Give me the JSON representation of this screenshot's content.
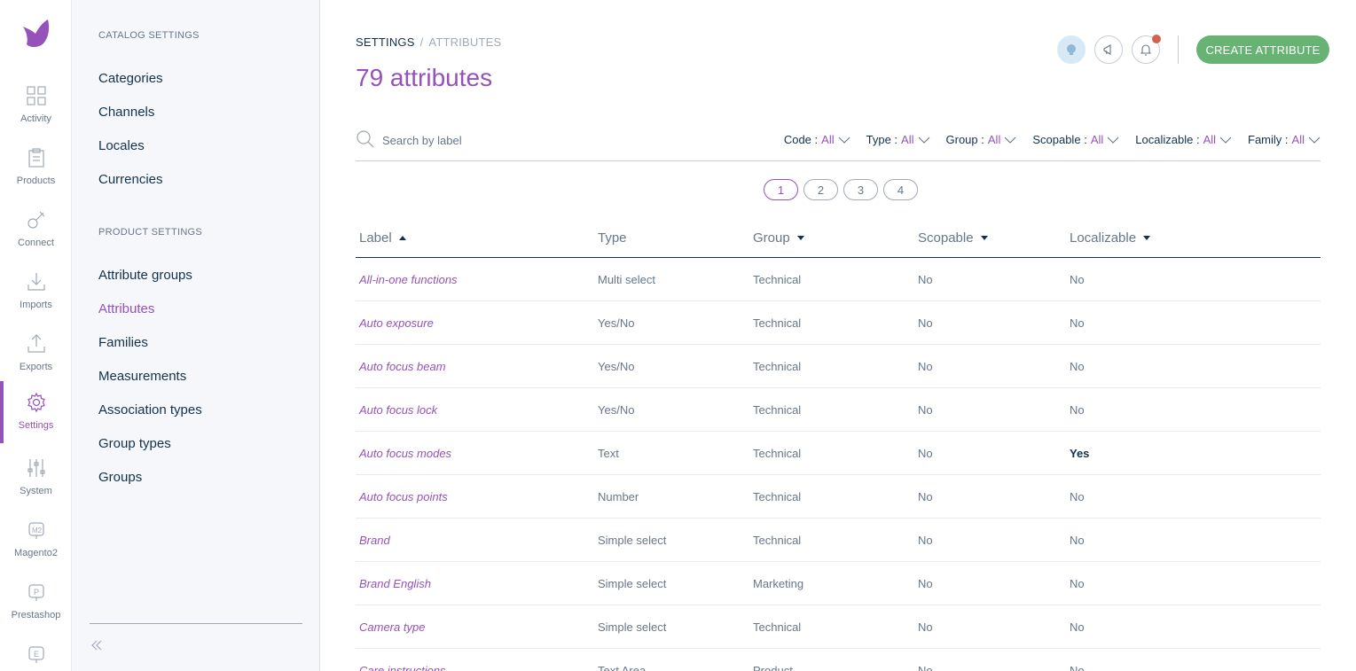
{
  "nav": {
    "items": [
      {
        "label": "Activity",
        "icon": "dashboard-icon"
      },
      {
        "label": "Products",
        "icon": "clipboard-icon"
      },
      {
        "label": "Connect",
        "icon": "plug-icon"
      },
      {
        "label": "Imports",
        "icon": "import-icon"
      },
      {
        "label": "Exports",
        "icon": "export-icon"
      },
      {
        "label": "Settings",
        "icon": "gear-icon",
        "active": true
      },
      {
        "label": "System",
        "icon": "sliders-icon"
      },
      {
        "label": "Magento2",
        "icon": "magento-icon"
      },
      {
        "label": "Prestashop",
        "icon": "prestashop-icon"
      }
    ],
    "accent": "#9452ba"
  },
  "panel": {
    "catalog_title": "CATALOG SETTINGS",
    "catalog_links": [
      "Categories",
      "Channels",
      "Locales",
      "Currencies"
    ],
    "product_title": "PRODUCT SETTINGS",
    "product_links": [
      "Attribute groups",
      "Attributes",
      "Families",
      "Measurements",
      "Association types",
      "Group types",
      "Groups"
    ],
    "active_link": "Attributes"
  },
  "header": {
    "breadcrumb_root": "SETTINGS",
    "breadcrumb_separator": "/",
    "breadcrumb_current": "ATTRIBUTES",
    "title": "79 attributes",
    "create_label": "CREATE ATTRIBUTE",
    "create_color": "#67b373",
    "notification_color": "#d4604f"
  },
  "search": {
    "placeholder": "Search by label"
  },
  "filters": [
    {
      "name": "Code",
      "value": "All"
    },
    {
      "name": "Type",
      "value": "All"
    },
    {
      "name": "Group",
      "value": "All"
    },
    {
      "name": "Scopable",
      "value": "All"
    },
    {
      "name": "Localizable",
      "value": "All"
    },
    {
      "name": "Family",
      "value": "All"
    }
  ],
  "filter_separator": ":",
  "pagination": {
    "pages": [
      "1",
      "2",
      "3",
      "4"
    ],
    "current": "1"
  },
  "table": {
    "columns": [
      "Label",
      "Type",
      "Group",
      "Scopable",
      "Localizable"
    ],
    "rows": [
      [
        "All-in-one functions",
        "Multi select",
        "Technical",
        "No",
        "No"
      ],
      [
        "Auto exposure",
        "Yes/No",
        "Technical",
        "No",
        "No"
      ],
      [
        "Auto focus beam",
        "Yes/No",
        "Technical",
        "No",
        "No"
      ],
      [
        "Auto focus lock",
        "Yes/No",
        "Technical",
        "No",
        "No"
      ],
      [
        "Auto focus modes",
        "Text",
        "Technical",
        "No",
        "Yes"
      ],
      [
        "Auto focus points",
        "Number",
        "Technical",
        "No",
        "No"
      ],
      [
        "Brand",
        "Simple select",
        "Technical",
        "No",
        "No"
      ],
      [
        "Brand English",
        "Simple select",
        "Marketing",
        "No",
        "No"
      ],
      [
        "Camera type",
        "Simple select",
        "Technical",
        "No",
        "No"
      ],
      [
        "Care instructions",
        "Text Area",
        "Product",
        "No",
        "No"
      ]
    ]
  }
}
